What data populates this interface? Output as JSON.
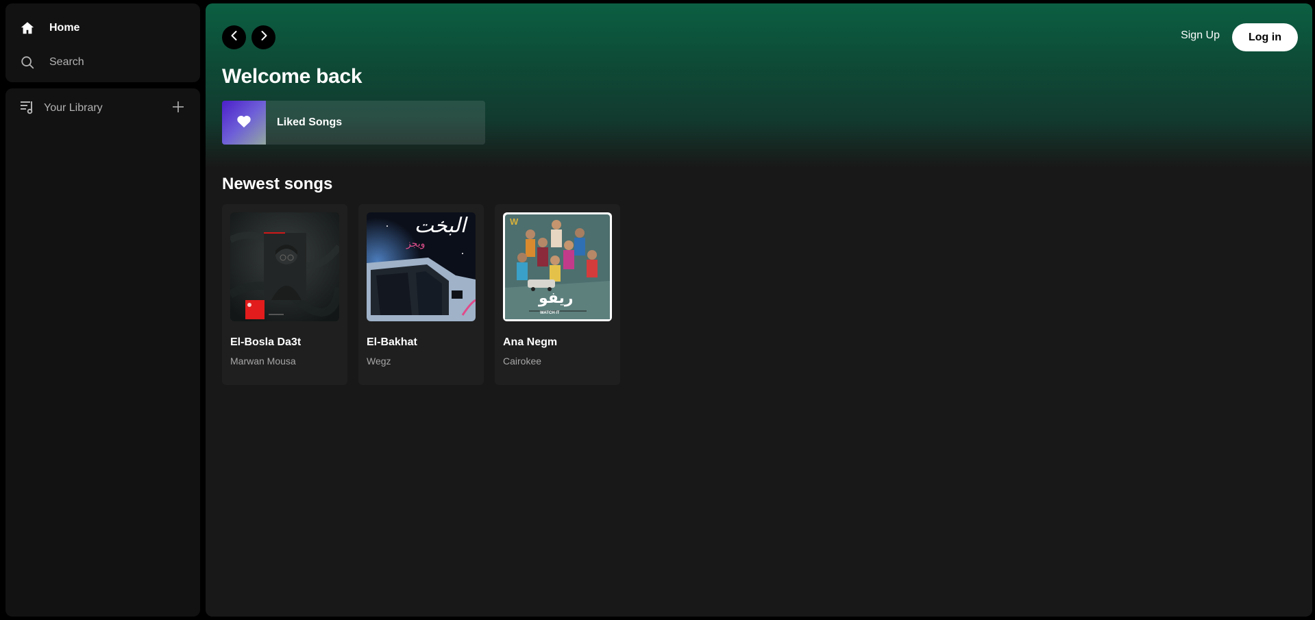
{
  "sidebar": {
    "nav": [
      {
        "label": "Home",
        "icon": "home-icon"
      },
      {
        "label": "Search",
        "icon": "search-icon"
      }
    ],
    "library": {
      "label": "Your Library",
      "icon": "library-icon",
      "add_icon": "plus-icon"
    }
  },
  "header": {
    "back_icon": "chevron-left-icon",
    "forward_icon": "chevron-right-icon",
    "signup_label": "Sign Up",
    "login_label": "Log in"
  },
  "main": {
    "welcome_title": "Welcome back",
    "liked": {
      "label": "Liked Songs",
      "icon": "heart-icon"
    },
    "newest_title": "Newest songs",
    "songs": [
      {
        "title": "El-Bosla Da3t",
        "artist": "Marwan Mousa"
      },
      {
        "title": "El-Bakhat",
        "artist": "Wegz",
        "cover_text": "البخت",
        "cover_subtext": "ويجز"
      },
      {
        "title": "Ana Negm",
        "artist": "Cairokee",
        "cover_text": "ريفو",
        "cover_badge": "W",
        "cover_caption": "WATCH IT"
      }
    ]
  },
  "colors": {
    "accent_green": "#0b5f42",
    "background": "#121212",
    "liked_gradient_start": "#4b1fc9"
  }
}
